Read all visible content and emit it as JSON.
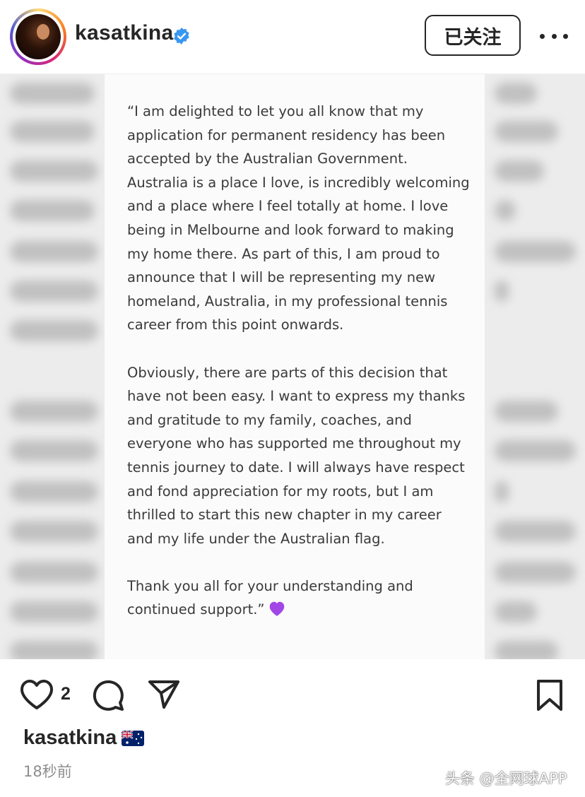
{
  "header": {
    "username": "kasatkina",
    "follow_label": "已关注"
  },
  "notice": {
    "paragraphs": [
      "“I am delighted to let you all know that my application for permanent residency has been accepted by the Australian Government. Australia is a place I love,  is incredibly welcoming and a place where I feel totally at home. I love being in Melbourne and look forward to making my home there. As part of this, I am proud to announce that I will be representing my new homeland, Australia, in my professional tennis career from this point onwards.",
      "Obviously, there are parts of this decision that have not been easy. I want to express my thanks and gratitude to my family, coaches, and everyone who has supported me throughout my tennis journey to date. I will always have respect and fond appreciation for my roots, but I am thrilled to start this new chapter in my career and my life under the Australian flag.",
      "Thank you all for your understanding and continued support.”"
    ]
  },
  "actions": {
    "like_count": "2"
  },
  "caption": {
    "username": "kasatkina",
    "time": "18秒前"
  },
  "watermark": "头条 @全网球APP",
  "colors": {
    "verified": "#3897f0",
    "text": "#262626",
    "muted": "#8e8e8e"
  },
  "icons": [
    "verified-badge-icon",
    "more-icon",
    "heart-icon",
    "comment-icon",
    "share-icon",
    "bookmark-icon",
    "purple-heart-icon",
    "australia-flag-icon"
  ]
}
